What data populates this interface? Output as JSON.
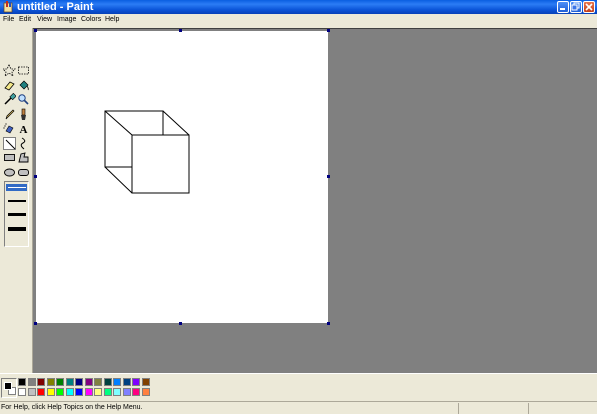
{
  "window": {
    "title": "untitled - Paint"
  },
  "menu": [
    {
      "label": "File"
    },
    {
      "label": "Edit"
    },
    {
      "label": "View"
    },
    {
      "label": "Image"
    },
    {
      "label": "Colors"
    },
    {
      "label": "Help"
    }
  ],
  "tools": [
    {
      "name": "free-form-select-icon"
    },
    {
      "name": "select-icon"
    },
    {
      "name": "eraser-icon"
    },
    {
      "name": "fill-with-color-icon"
    },
    {
      "name": "pick-color-icon"
    },
    {
      "name": "magnifier-icon"
    },
    {
      "name": "pencil-icon"
    },
    {
      "name": "brush-icon"
    },
    {
      "name": "airbrush-icon"
    },
    {
      "name": "text-icon"
    },
    {
      "name": "line-icon",
      "selected": true
    },
    {
      "name": "curve-icon"
    },
    {
      "name": "rectangle-icon"
    },
    {
      "name": "polygon-icon"
    },
    {
      "name": "ellipse-icon"
    },
    {
      "name": "rounded-rectangle-icon"
    }
  ],
  "palette": {
    "foreground": "#000000",
    "background": "#ffffff",
    "top_row": [
      "#000000",
      "#808080",
      "#800000",
      "#808000",
      "#008000",
      "#008080",
      "#000080",
      "#800080",
      "#808040",
      "#004040",
      "#0080ff",
      "#004080",
      "#8000ff",
      "#804000"
    ],
    "bottom_row": [
      "#ffffff",
      "#c0c0c0",
      "#ff0000",
      "#ffff00",
      "#00ff00",
      "#00ffff",
      "#0000ff",
      "#ff00ff",
      "#ffff80",
      "#00ff80",
      "#80ffff",
      "#8080ff",
      "#ff0080",
      "#ff8040"
    ]
  },
  "status": {
    "text": "For Help, click Help Topics on the Help Menu."
  }
}
